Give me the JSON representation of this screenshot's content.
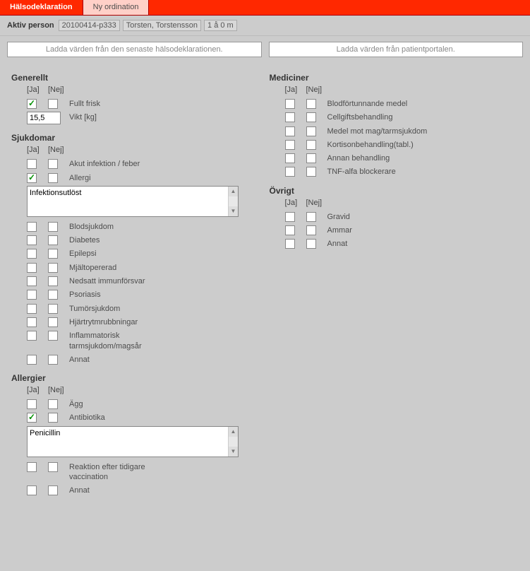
{
  "tabs": {
    "active": "Hälsodeklaration",
    "inactive": "Ny ordination"
  },
  "infobar": {
    "label": "Aktiv person",
    "id": "20100414-p333",
    "name": "Torsten, Torstensson",
    "age": "1 å 0 m"
  },
  "buttons": {
    "load_prev": "Ladda värden från den senaste hälsodeklarationen.",
    "load_portal": "Ladda värden från patientportalen."
  },
  "headers": {
    "ja": "[Ja]",
    "nej": "[Nej]"
  },
  "generellt": {
    "title": "Generellt",
    "fullt_frisk": "Fullt frisk",
    "vikt_label": "Vikt [kg]",
    "vikt_value": "15,5"
  },
  "sjukdomar": {
    "title": "Sjukdomar",
    "items": [
      "Akut infektion / feber",
      "Allergi"
    ],
    "allergi_text": "Infektionsutlöst",
    "items2": [
      "Blodsjukdom",
      "Diabetes",
      "Epilepsi",
      "Mjältopererad",
      "Nedsatt immunförsvar",
      "Psoriasis",
      "Tumörsjukdom",
      "Hjärtrytmrubbningar",
      "Inflammatorisk tarmsjukdom/magsår",
      "Annat"
    ]
  },
  "allergier": {
    "title": "Allergier",
    "items": [
      "Ägg",
      "Antibiotika"
    ],
    "antibiotika_text": "Penicillin",
    "items2": [
      "Reaktion efter tidigare vaccination",
      "Annat"
    ]
  },
  "mediciner": {
    "title": "Mediciner",
    "items": [
      "Blodförtunnande medel",
      "Cellgiftsbehandling",
      "Medel mot mag/tarmsjukdom",
      "Kortisonbehandling(tabl.)",
      "Annan behandling",
      "TNF-alfa blockerare"
    ]
  },
  "ovrigt": {
    "title": "Övrigt",
    "items": [
      "Gravid",
      "Ammar",
      "Annat"
    ]
  }
}
